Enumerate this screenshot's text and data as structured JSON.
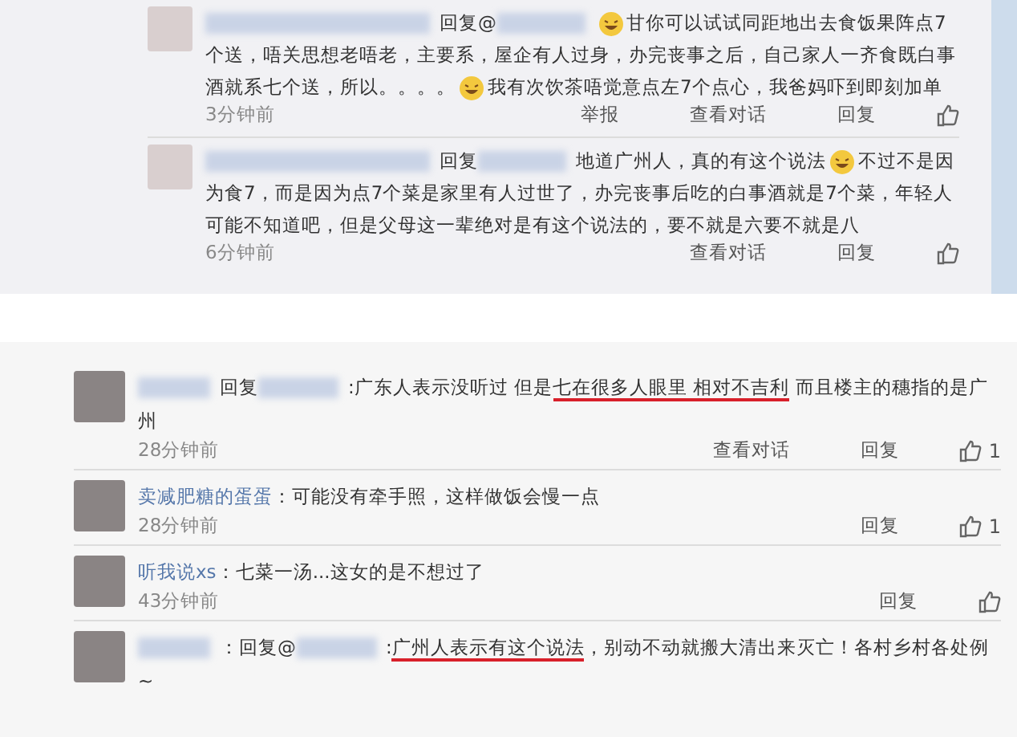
{
  "top_thread": {
    "comments": [
      {
        "segments": [
          {
            "kind": "blurred"
          },
          {
            "kind": "text",
            "text": "回复@"
          },
          {
            "kind": "blurred"
          },
          {
            "kind": "emoji"
          },
          {
            "kind": "text",
            "text": "甘你可以试试同距地出去食饭果阵点7个送，唔关思想老唔老，主要系，屋企有人过身，办完丧事之后，自己家人一齐食既白事酒就系七个送，所以。。。。"
          },
          {
            "kind": "emoji"
          },
          {
            "kind": "text",
            "text": "我有次饮茶唔觉意点左7个点心，我爸妈吓到即刻加单"
          }
        ],
        "time": "3分钟前",
        "actions": [
          {
            "kind": "text",
            "label": "举报"
          },
          {
            "kind": "text",
            "label": "查看对话"
          },
          {
            "kind": "text",
            "label": "回复"
          },
          {
            "kind": "like"
          }
        ]
      },
      {
        "segments": [
          {
            "kind": "blurred"
          },
          {
            "kind": "text",
            "text": "回复"
          },
          {
            "kind": "blurred"
          },
          {
            "kind": "text",
            "text": "地道广州人，真的有这个说法"
          },
          {
            "kind": "emoji"
          },
          {
            "kind": "text",
            "text": "不过不是因为食7，而是因为点7个菜是家里有人过世了，办完丧事后吃的白事酒就是7个菜，年轻人可能不知道吧，但是父母这一辈绝对是有这个说法的，要不就是六要不就是八"
          }
        ],
        "time": "6分钟前",
        "actions": [
          {
            "kind": "text",
            "label": "查看对话"
          },
          {
            "kind": "text",
            "label": "回复"
          },
          {
            "kind": "like"
          }
        ]
      }
    ]
  },
  "bottom_thread": {
    "comments": [
      {
        "segments": [
          {
            "kind": "blurred"
          },
          {
            "kind": "text",
            "text": "回复"
          },
          {
            "kind": "blurred"
          },
          {
            "kind": "text",
            "text": ":广东人表示没听过 但是"
          },
          {
            "kind": "underlined",
            "text": "七在很多人眼里 相对不吉利"
          },
          {
            "kind": "text",
            "text": " 而且楼主的穗指的是广州"
          }
        ],
        "time": "28分钟前",
        "actions": [
          {
            "kind": "text",
            "label": "查看对话"
          },
          {
            "kind": "text",
            "label": "回复"
          },
          {
            "kind": "like",
            "count": "1"
          }
        ]
      },
      {
        "segments": [
          {
            "kind": "name",
            "text": "卖减肥糖的蛋蛋"
          },
          {
            "kind": "text",
            "text": "：可能没有牵手照，这样做饭会慢一点"
          }
        ],
        "time": "28分钟前",
        "actions": [
          {
            "kind": "text",
            "label": "回复"
          },
          {
            "kind": "like",
            "count": "1"
          }
        ]
      },
      {
        "segments": [
          {
            "kind": "name",
            "text": "听我说xs"
          },
          {
            "kind": "text",
            "text": "：七菜一汤...这女的是不想过了"
          }
        ],
        "time": "43分钟前",
        "actions": [
          {
            "kind": "text",
            "label": "回复"
          },
          {
            "kind": "like"
          }
        ]
      },
      {
        "segments": [
          {
            "kind": "blurred"
          },
          {
            "kind": "text",
            "text": "：回复@"
          },
          {
            "kind": "blurred"
          },
          {
            "kind": "text",
            "text": ":"
          },
          {
            "kind": "underlined",
            "text": "广州人表示有这个说法"
          },
          {
            "kind": "text",
            "text": "，别动不动就搬大清出来灭亡！各村乡村各处例~"
          }
        ]
      }
    ]
  }
}
